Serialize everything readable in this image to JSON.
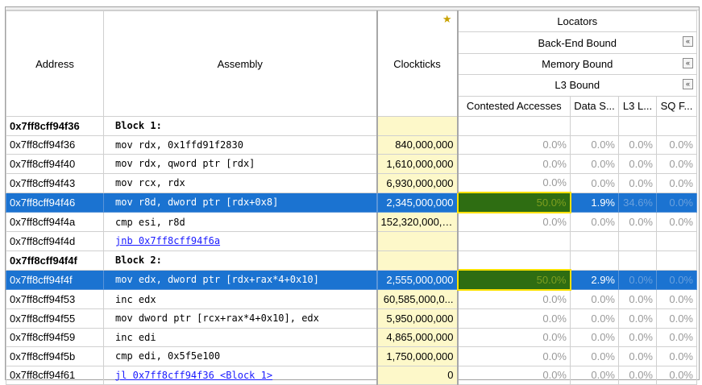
{
  "headers": {
    "address": "Address",
    "assembly": "Assembly",
    "clockticks": "Clockticks",
    "locators": "Locators",
    "back_end_bound": "Back-End Bound",
    "memory_bound": "Memory Bound",
    "l3_bound": "L3 Bound",
    "contested_accesses": "Contested Accesses",
    "data_sharing": "Data S...",
    "l3_latency": "L3 L...",
    "sq_full": "SQ F...",
    "collapse_glyph": "«",
    "star_icon": "star-icon"
  },
  "rows": [
    {
      "type": "block",
      "address": "0x7ff8cff94f36",
      "assembly": "Block 1:",
      "clockticks": "",
      "contested": "",
      "data_s": "",
      "l3_l": "",
      "sq_f": ""
    },
    {
      "type": "normal",
      "address": "0x7ff8cff94f36",
      "assembly": "mov rdx, 0x1ffd91f2830",
      "clockticks": "840,000,000",
      "contested": "0.0%",
      "data_s": "0.0%",
      "l3_l": "0.0%",
      "sq_f": "0.0%"
    },
    {
      "type": "normal",
      "address": "0x7ff8cff94f40",
      "assembly": "mov rdx, qword ptr [rdx]",
      "clockticks": "1,610,000,000",
      "contested": "0.0%",
      "data_s": "0.0%",
      "l3_l": "0.0%",
      "sq_f": "0.0%"
    },
    {
      "type": "normal",
      "address": "0x7ff8cff94f43",
      "assembly": "mov rcx, rdx",
      "clockticks": "6,930,000,000",
      "contested": "0.0%",
      "data_s": "0.0%",
      "l3_l": "0.0%",
      "sq_f": "0.0%"
    },
    {
      "type": "selected",
      "address": "0x7ff8cff94f46",
      "assembly": "mov r8d, dword ptr [rdx+0x8]",
      "clockticks": "2,345,000,000",
      "contested": "50.0%",
      "data_s": "1.9%",
      "l3_l": "34.6%",
      "sq_f": "0.0%"
    },
    {
      "type": "normal",
      "address": "0x7ff8cff94f4a",
      "assembly": "cmp esi, r8d",
      "clockticks": "152,320,000, ...",
      "contested": "0.0%",
      "data_s": "0.0%",
      "l3_l": "0.0%",
      "sq_f": "0.0%"
    },
    {
      "type": "link",
      "address": "0x7ff8cff94f4d",
      "assembly": "jnb 0x7ff8cff94f6a",
      "clockticks": "",
      "contested": "",
      "data_s": "",
      "l3_l": "",
      "sq_f": ""
    },
    {
      "type": "block",
      "address": "0x7ff8cff94f4f",
      "assembly": "Block 2:",
      "clockticks": "",
      "contested": "",
      "data_s": "",
      "l3_l": "",
      "sq_f": ""
    },
    {
      "type": "selected",
      "address": "0x7ff8cff94f4f",
      "assembly": "mov edx, dword ptr [rdx+rax*4+0x10]",
      "clockticks": "2,555,000,000",
      "contested": "50.0%",
      "data_s": "2.9%",
      "l3_l": "0.0%",
      "sq_f": "0.0%"
    },
    {
      "type": "normal",
      "address": "0x7ff8cff94f53",
      "assembly": "inc edx",
      "clockticks": "60,585,000,0...",
      "contested": "0.0%",
      "data_s": "0.0%",
      "l3_l": "0.0%",
      "sq_f": "0.0%"
    },
    {
      "type": "normal",
      "address": "0x7ff8cff94f55",
      "assembly": "mov dword ptr [rcx+rax*4+0x10], edx",
      "clockticks": "5,950,000,000",
      "contested": "0.0%",
      "data_s": "0.0%",
      "l3_l": "0.0%",
      "sq_f": "0.0%"
    },
    {
      "type": "normal",
      "address": "0x7ff8cff94f59",
      "assembly": "inc edi",
      "clockticks": "4,865,000,000",
      "contested": "0.0%",
      "data_s": "0.0%",
      "l3_l": "0.0%",
      "sq_f": "0.0%"
    },
    {
      "type": "normal",
      "address": "0x7ff8cff94f5b",
      "assembly": "cmp edi, 0x5f5e100",
      "clockticks": "1,750,000,000",
      "contested": "0.0%",
      "data_s": "0.0%",
      "l3_l": "0.0%",
      "sq_f": "0.0%"
    },
    {
      "type": "link",
      "address": "0x7ff8cff94f61",
      "assembly": "jl 0x7ff8cff94f36 <Block 1>",
      "clockticks": "0",
      "contested": "0.0%",
      "data_s": "0.0%",
      "l3_l": "0.0%",
      "sq_f": "0.0%"
    }
  ]
}
